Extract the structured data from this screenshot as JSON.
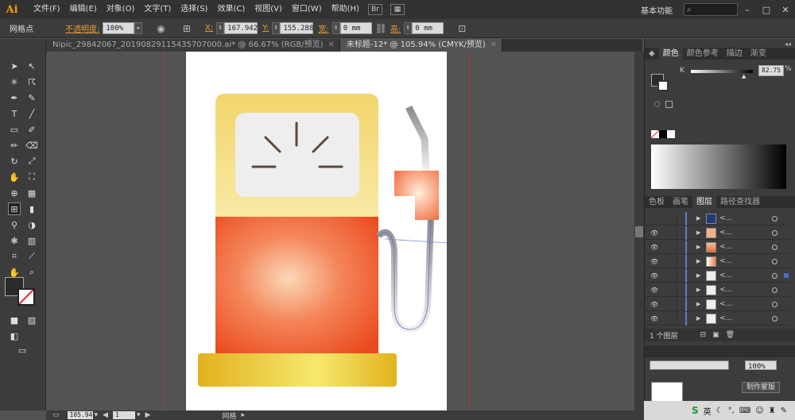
{
  "app": {
    "logo": "Ai"
  },
  "menu": [
    "文件(F)",
    "编辑(E)",
    "对象(O)",
    "文字(T)",
    "选择(S)",
    "效果(C)",
    "视图(V)",
    "窗口(W)",
    "帮助(H)"
  ],
  "workspace": "基本功能",
  "control": {
    "selection_label": "网格点",
    "opacity_label": "不透明度:",
    "opacity_value": "100%",
    "x_label": "X:",
    "x_value": "167.942",
    "y_label": "Y:",
    "y_value": "155.288",
    "w_label": "宽:",
    "w_value": "0 mm",
    "h_label": "高:",
    "h_value": "0 mm"
  },
  "tabs": [
    {
      "label": "Nipic_29842067_20190829115435707000.ai* @ 66.67% (RGB/预览)",
      "active": false
    },
    {
      "label": "未标题-12* @ 105.94% (CMYK/预览)",
      "active": true
    }
  ],
  "color_panel": {
    "tabs": [
      "颜色",
      "颜色参考",
      "描边",
      "渐变"
    ],
    "channel": "K",
    "value": "82.75",
    "slider_fraction": 0.83
  },
  "layers_panel": {
    "tabs": [
      "色板",
      "画笔",
      "图层",
      "路径查找器"
    ],
    "item_label": "<...",
    "footer": "1 个图层"
  },
  "transparency": {
    "label": "制作蒙版"
  },
  "status": {
    "zoom": "105.94",
    "page": "1",
    "tool": "网格"
  },
  "taskbar": {
    "ime": "英"
  },
  "colors": {
    "pump_top": "#f4d77a",
    "pump_body": "#f06a3a",
    "base": "#e8c23a",
    "nozzle": "#f47b52"
  }
}
